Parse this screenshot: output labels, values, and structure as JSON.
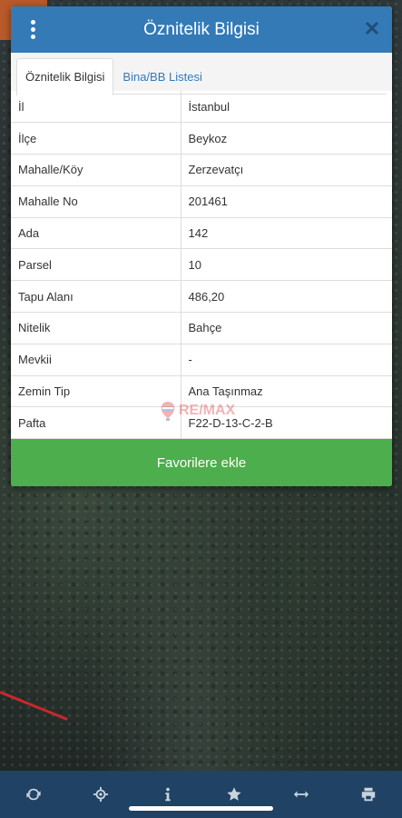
{
  "dialog": {
    "title": "Öznitelik Bilgisi",
    "close_glyph": "✕"
  },
  "tabs": [
    {
      "label": "Öznitelik Bilgisi",
      "active": true
    },
    {
      "label": "Bina/BB Listesi",
      "active": false
    }
  ],
  "attributes": [
    {
      "key": "İl",
      "value": "İstanbul"
    },
    {
      "key": "İlçe",
      "value": "Beykoz"
    },
    {
      "key": "Mahalle/Köy",
      "value": "Zerzevatçı"
    },
    {
      "key": "Mahalle No",
      "value": "201461"
    },
    {
      "key": "Ada",
      "value": "142"
    },
    {
      "key": "Parsel",
      "value": "10"
    },
    {
      "key": "Tapu Alanı",
      "value": "486,20"
    },
    {
      "key": "Nitelik",
      "value": "Bahçe"
    },
    {
      "key": "Mevkii",
      "value": "-"
    },
    {
      "key": "Zemin Tip",
      "value": "Ana Taşınmaz"
    },
    {
      "key": "Pafta",
      "value": "F22-D-13-C-2-B"
    }
  ],
  "favorite_button": "Favorilere ekle",
  "watermark": "RE/MAX",
  "toolbar": {
    "icons": [
      "refresh-icon",
      "locate-icon",
      "info-icon",
      "star-icon",
      "measure-icon",
      "print-icon"
    ]
  },
  "colors": {
    "header": "#337ab7",
    "favorite": "#4cae4c",
    "toolbar": "#1f4265"
  }
}
